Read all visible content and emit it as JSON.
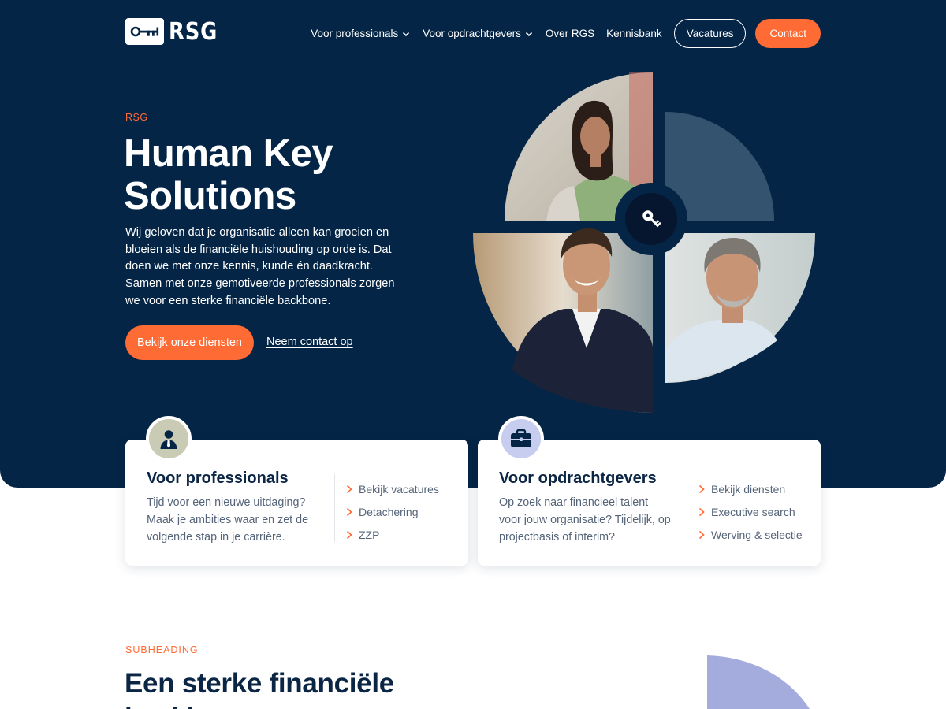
{
  "brand": {
    "logo_text": "RSG"
  },
  "nav": {
    "items": [
      {
        "label": "Voor professionals",
        "has_dropdown": true
      },
      {
        "label": "Voor opdrachtgevers",
        "has_dropdown": true
      },
      {
        "label": "Over RGS",
        "has_dropdown": false
      },
      {
        "label": "Kennisbank",
        "has_dropdown": false
      }
    ],
    "vacatures_label": "Vacatures",
    "contact_label": "Contact"
  },
  "hero": {
    "eyebrow": "RSG",
    "title": "Human Key Solutions",
    "body": "Wij geloven dat je organisatie alleen kan groeien en bloeien als de financiële huishouding op orde is. Dat doen we met onze kennis, kunde én daadkracht. Samen met onze gemotiveerde professionals zorgen we voor een sterke financiële backbone.",
    "primary_cta": "Bekijk onze diensten",
    "secondary_cta": "Neem contact op"
  },
  "cards": [
    {
      "icon": "person-icon",
      "title": "Voor professionals",
      "text": "Tijd voor een nieuwe uitdaging? Maak je ambities waar en zet de volgende stap in je carrière.",
      "links": [
        "Bekijk vacatures",
        "Detachering",
        "ZZP"
      ]
    },
    {
      "icon": "briefcase-icon",
      "title": "Voor opdrachtgevers",
      "text": "Op zoek naar financieel talent voor jouw organisatie? Tijdelijk, op projectbasis of interim?",
      "links": [
        "Bekijk diensten",
        "Executive search",
        "Werving & selectie"
      ]
    }
  ],
  "section": {
    "subheading": "SUBHEADING",
    "title": "Een sterke financiële backbone"
  },
  "colors": {
    "navy": "#042546",
    "accent": "#ff6b35",
    "slate_quadrant": "#33536f",
    "periwinkle": "#a3acdc"
  }
}
